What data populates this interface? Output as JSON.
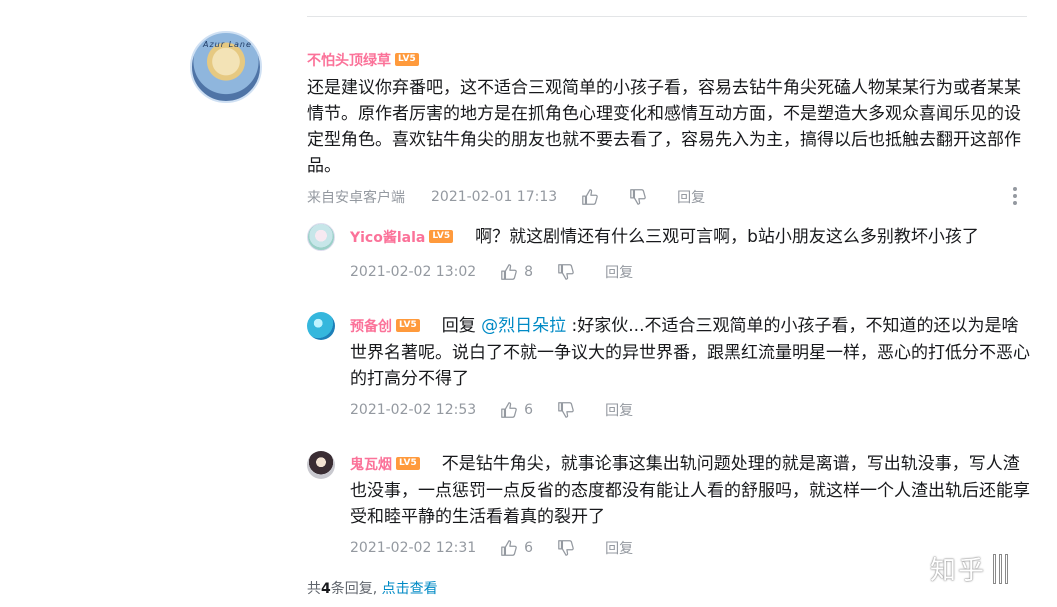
{
  "main_comment": {
    "username": "不怕头顶绿草",
    "level": "LV5",
    "avatar_ring_text": "Azur Lane",
    "text": "还是建议你弃番吧，这不适合三观简单的小孩子看，容易去钻牛角尖死磕人物某某行为或者某某情节。原作者厉害的地方是在抓角色心理变化和感情互动方面，不是塑造大多观众喜闻乐见的设定型角色。喜欢钻牛角尖的朋友也就不要去看了，容易先入为主，搞得以后也抵触去翻开这部作品。",
    "source": "来自安卓客户端",
    "time": "2021-02-01 17:13",
    "reply_label": "回复"
  },
  "replies": [
    {
      "username": "Yico酱lala",
      "level": "LV5",
      "text": "啊？就这剧情还有什么三观可言啊，b站小朋友这么多别教坏小孩了",
      "time": "2021-02-02 13:02",
      "likes": "8",
      "reply_label": "回复"
    },
    {
      "username": "预备创",
      "level": "LV5",
      "reply_prefix": "回复",
      "at_user": "@烈日朵拉",
      "text": ":好家伙...不适合三观简单的小孩子看，不知道的还以为是啥世界名著呢。说白了不就一争议大的异世界番，跟黑红流量明星一样，恶心的打低分不恶心的打高分不得了",
      "time": "2021-02-02 12:53",
      "likes": "6",
      "reply_label": "回复"
    },
    {
      "username": "鬼瓦烟",
      "level": "LV5",
      "text": "不是钻牛角尖，就事论事这集出轨问题处理的就是离谱，写出轨没事，写人渣也没事，一点惩罚一点反省的态度都没有能让人看的舒服吗，就这样一个人渣出轨后还能享受和睦平静的生活看着真的裂开了",
      "time": "2021-02-02 12:31",
      "likes": "6",
      "reply_label": "回复"
    }
  ],
  "footer": {
    "prefix": "共",
    "count": "4",
    "suffix": "条回复,",
    "view_link": "点击查看"
  },
  "watermark": "知乎",
  "colors": {
    "username": "#fb7299",
    "level_badge": "#ff9a3c",
    "link": "#008ac5",
    "meta": "#9499a0"
  },
  "icons": {
    "like": "thumb-up-icon",
    "dislike": "thumb-down-icon",
    "more": "more-vertical-icon"
  }
}
